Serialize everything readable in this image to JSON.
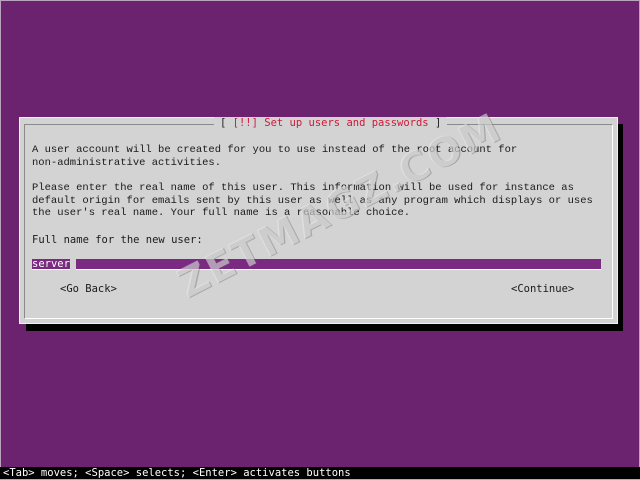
{
  "dialog": {
    "title_left": "[",
    "title": "[!!] Set up users and passwords",
    "title_right": "]",
    "paragraph1": "A user account will be created for you to use instead of the root account for\nnon-administrative activities.",
    "paragraph2": "Please enter the real name of this user. This information will be used for instance as\ndefault origin for emails sent by this user as well as any program which displays or uses\nthe user's real name. Your full name is a reasonable choice.",
    "field_label": "Full name for the new user:",
    "field_value": "server",
    "go_back_label": "<Go Back>",
    "continue_label": "<Continue>"
  },
  "statusbar": {
    "text": "<Tab> moves; <Space> selects; <Enter> activates buttons"
  },
  "watermark": {
    "text": "ZETMAGZ.COM"
  },
  "colors": {
    "background": "#6b2370",
    "dialog": "#d3d3d3",
    "title": "#d0183a",
    "input_field": "#7a2a80",
    "statusbar": "#000000"
  }
}
